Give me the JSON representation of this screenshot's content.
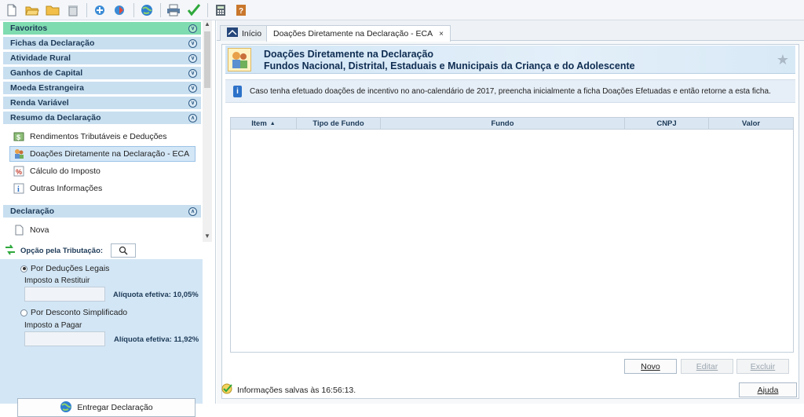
{
  "toolbar": {
    "icons": [
      "new-document-icon",
      "open-folder-icon",
      "folder-icon",
      "trash-icon",
      "import-icon",
      "transmit-icon",
      "globe-icon",
      "print-icon",
      "check-icon",
      "calculator-icon",
      "help-book-icon"
    ]
  },
  "sidebar": {
    "sections": [
      {
        "label": "Favoritos",
        "state": "collapsed"
      },
      {
        "label": "Fichas da Declaração",
        "state": "collapsed"
      },
      {
        "label": "Atividade Rural",
        "state": "collapsed"
      },
      {
        "label": "Ganhos de Capital",
        "state": "collapsed"
      },
      {
        "label": "Moeda Estrangeira",
        "state": "collapsed"
      },
      {
        "label": "Renda Variável",
        "state": "collapsed"
      },
      {
        "label": "Resumo da Declaração",
        "state": "expanded"
      }
    ],
    "resumo_items": [
      {
        "label": "Rendimentos Tributáveis e Deduções",
        "icon": "money-icon"
      },
      {
        "label": "Doações Diretamente na Declaração - ECA",
        "icon": "children-icon",
        "selected": true
      },
      {
        "label": "Cálculo do Imposto",
        "icon": "percent-icon"
      },
      {
        "label": "Outras Informações",
        "icon": "info-icon"
      }
    ],
    "declaracao_section": {
      "label": "Declaração",
      "state": "expanded"
    },
    "declaracao_items": [
      {
        "label": "Nova",
        "icon": "page-icon"
      }
    ]
  },
  "opcao": {
    "title": "Opção pela Tributação:",
    "deducoes": {
      "label": "Por Deduções Legais",
      "selected": true,
      "field_label": "Imposto a Restituir",
      "aliquota": "Alíquota efetiva: 10,05%"
    },
    "simplificado": {
      "label": "Por Desconto Simplificado",
      "selected": false,
      "field_label": "Imposto a Pagar",
      "aliquota": "Alíquota efetiva: 11,92%"
    },
    "entregar": "Entregar Declaração"
  },
  "tabs": [
    {
      "label": "Início",
      "closable": false
    },
    {
      "label": "Doações Diretamente na Declaração - ECA",
      "closable": true,
      "active": true
    }
  ],
  "banner": {
    "title": "Doações Diretamente na Declaração",
    "subtitle": "Fundos Nacional, Distrital, Estaduais e Municipais da Criança e do Adolescente"
  },
  "info_text": "Caso tenha efetuado doações de incentivo no ano-calendário de 2017, preencha inicialmente a ficha Doações Efetuadas e então retorne a esta ficha.",
  "table": {
    "columns": [
      "Item",
      "Tipo de Fundo",
      "Fundo",
      "CNPJ",
      "Valor"
    ],
    "sort_indicator": "▲",
    "rows": []
  },
  "buttons": {
    "novo": "Novo",
    "editar": "Editar",
    "excluir": "Excluir",
    "ajuda": "Ajuda"
  },
  "status": "Informações salvas às 16:56:13.",
  "colors": {
    "favoritos_header": "#7fdcb0",
    "section_header": "#c8dff0",
    "option_panel": "#d3e6f5",
    "accent_blue": "#2d72c9"
  }
}
